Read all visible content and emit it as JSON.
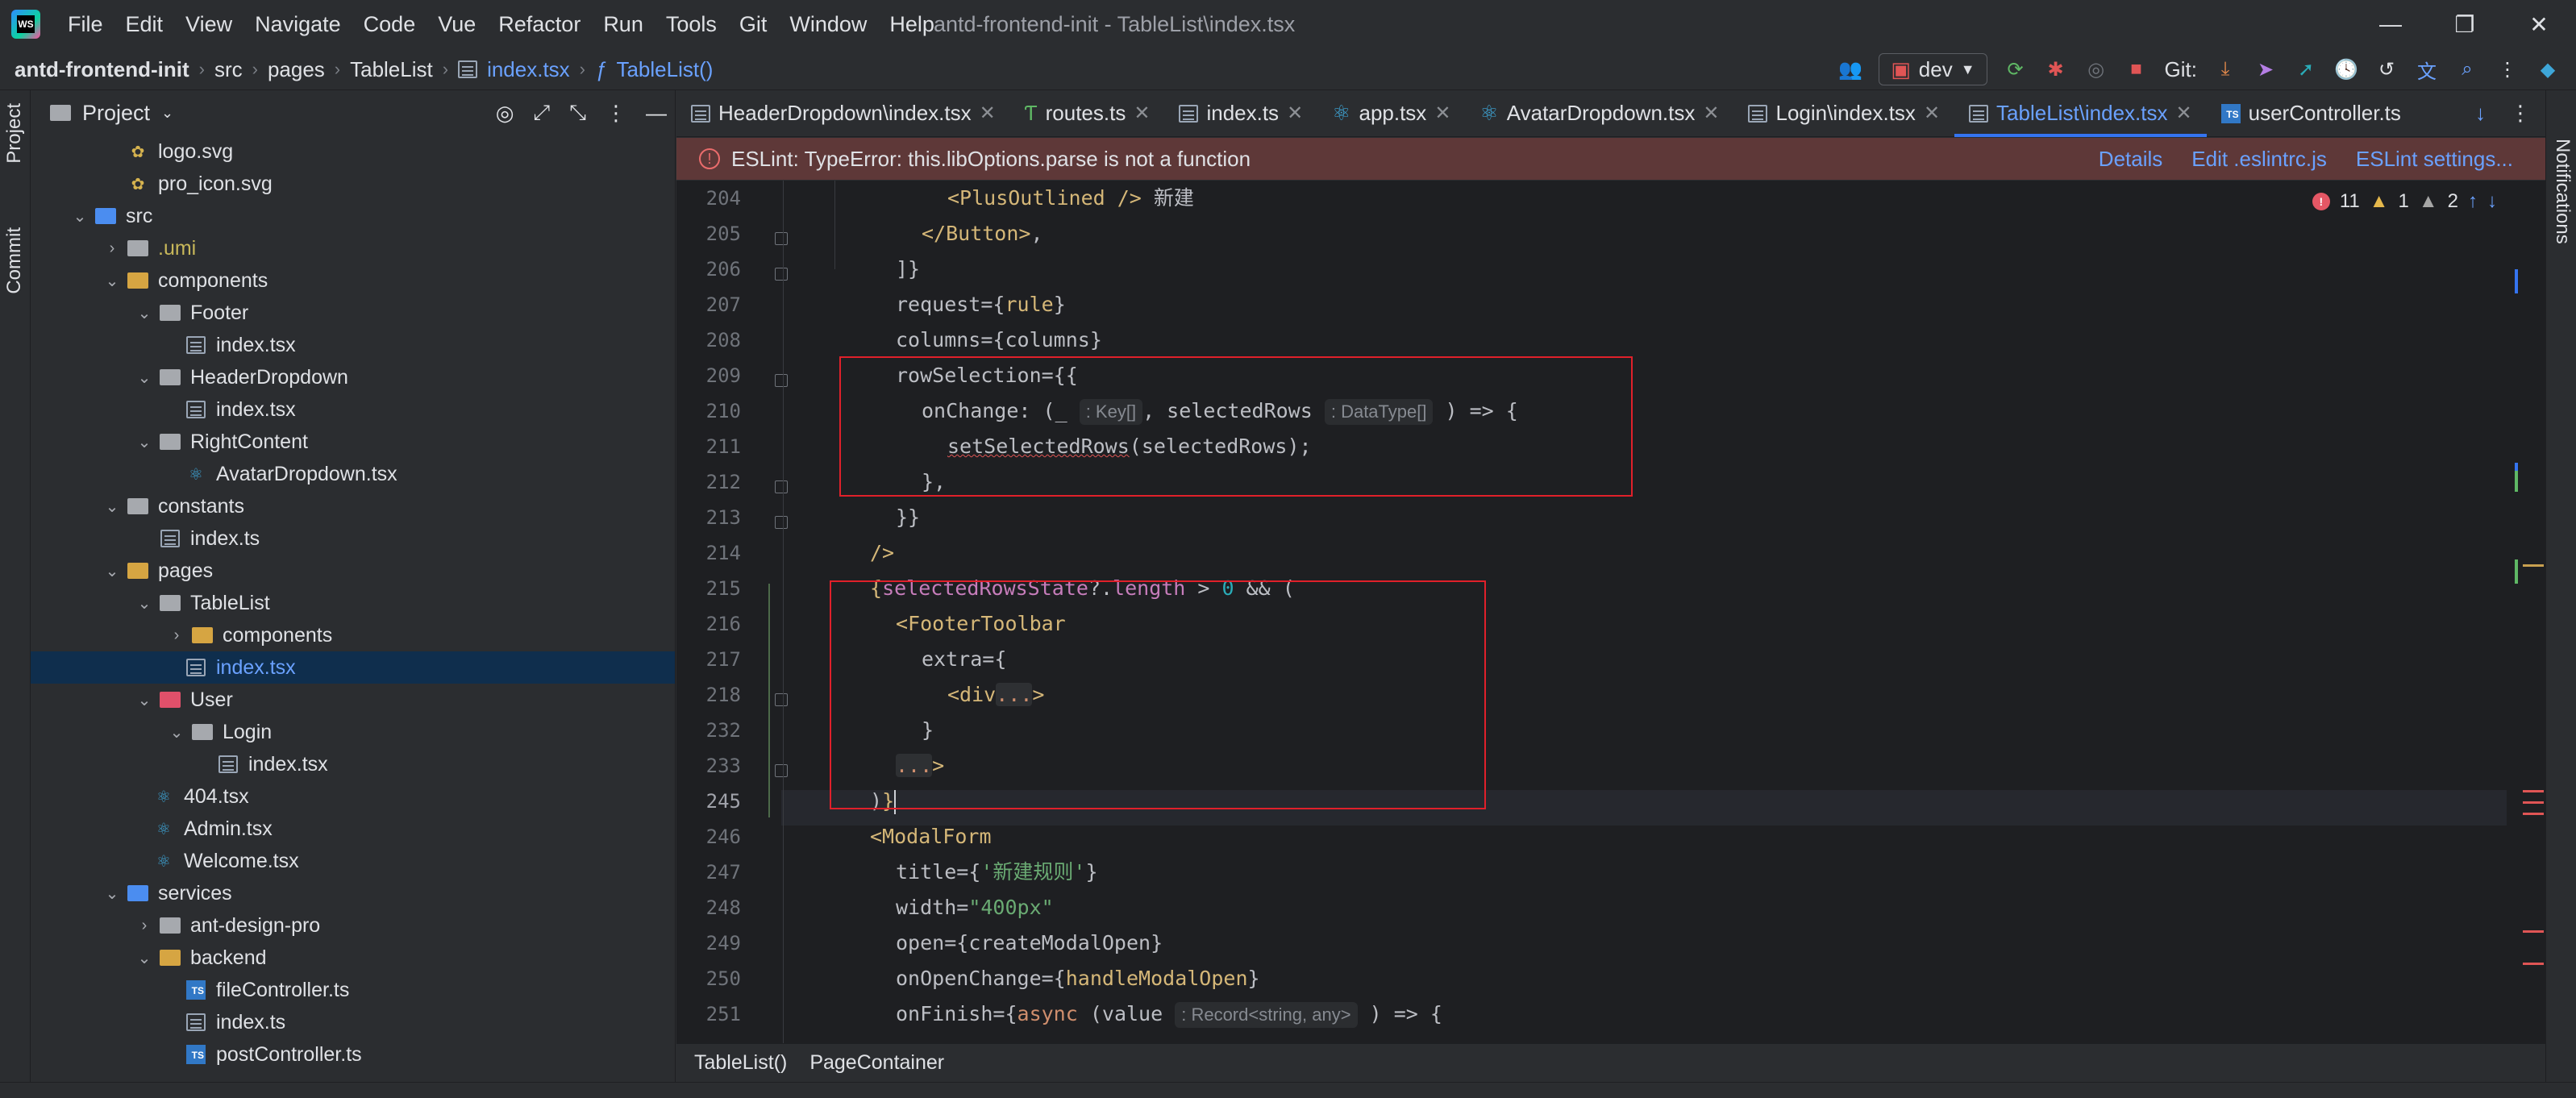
{
  "menu": {
    "items": [
      "File",
      "Edit",
      "View",
      "Navigate",
      "Code",
      "Vue",
      "Refactor",
      "Run",
      "Tools",
      "Git",
      "Window",
      "Help"
    ],
    "window_title": "antd-frontend-init - TableList\\index.tsx"
  },
  "nav": {
    "project": "antd-frontend-init",
    "crumb1": "src",
    "crumb2": "pages",
    "crumb3": "TableList",
    "crumb4": "index.tsx",
    "crumb5": "TableList()",
    "run_config": "dev",
    "git_label": "Git:"
  },
  "strips": {
    "project": "Project",
    "commit": "Commit",
    "notifications": "Notifications"
  },
  "project_panel": {
    "title": "Project",
    "rows": [
      {
        "label": "logo.svg"
      },
      {
        "label": "pro_icon.svg"
      },
      {
        "label": "src"
      },
      {
        "label": ".umi"
      },
      {
        "label": "components"
      },
      {
        "label": "Footer"
      },
      {
        "label": "index.tsx"
      },
      {
        "label": "HeaderDropdown"
      },
      {
        "label": "index.tsx"
      },
      {
        "label": "RightContent"
      },
      {
        "label": "AvatarDropdown.tsx"
      },
      {
        "label": "constants"
      },
      {
        "label": "index.ts"
      },
      {
        "label": "pages"
      },
      {
        "label": "TableList"
      },
      {
        "label": "components"
      },
      {
        "label": "index.tsx"
      },
      {
        "label": "User"
      },
      {
        "label": "Login"
      },
      {
        "label": "index.tsx"
      },
      {
        "label": "404.tsx"
      },
      {
        "label": "Admin.tsx"
      },
      {
        "label": "Welcome.tsx"
      },
      {
        "label": "services"
      },
      {
        "label": "ant-design-pro"
      },
      {
        "label": "backend"
      },
      {
        "label": "fileController.ts"
      },
      {
        "label": "index.ts"
      },
      {
        "label": "postController.ts"
      }
    ]
  },
  "tabs": [
    {
      "label": "HeaderDropdown\\index.tsx"
    },
    {
      "label": "routes.ts"
    },
    {
      "label": "index.ts"
    },
    {
      "label": "app.tsx"
    },
    {
      "label": "AvatarDropdown.tsx"
    },
    {
      "label": "Login\\index.tsx"
    },
    {
      "label": "TableList\\index.tsx"
    },
    {
      "label": "userController.ts"
    }
  ],
  "banner": {
    "message": "ESLint: TypeError: this.libOptions.parse is not a function",
    "details": "Details",
    "edit": "Edit .eslintrc.js",
    "settings": "ESLint settings..."
  },
  "inspections": {
    "errors": "11",
    "warnings": "1",
    "weak": "2"
  },
  "editor": {
    "line_numbers": [
      "204",
      "205",
      "206",
      "207",
      "208",
      "209",
      "210",
      "211",
      "212",
      "213",
      "214",
      "215",
      "216",
      "217",
      "218",
      "232",
      "233",
      "245",
      "246",
      "247",
      "248",
      "249",
      "250",
      "251"
    ],
    "hints": {
      "key": ": Key[]",
      "datatype": ": DataType[]",
      "record": ": Record<string, any>"
    },
    "cn_new": "新建",
    "cn_title": "'新建规则'",
    "width_val": "\"400px\""
  },
  "bottom": {
    "crumb1": "TableList()",
    "crumb2": "PageContainer"
  }
}
